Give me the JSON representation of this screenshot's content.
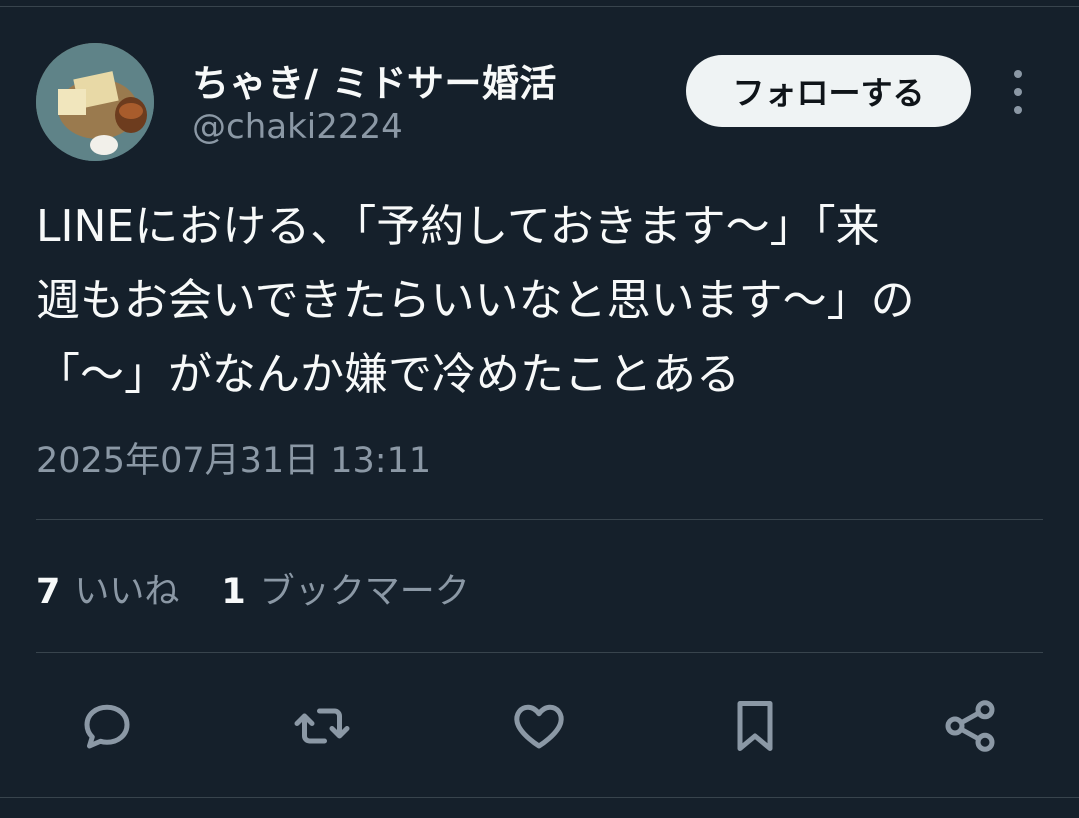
{
  "author": {
    "display_name": "ちゃき/ ミドサー婚活",
    "handle": "@chaki2224"
  },
  "follow_label": "フォローする",
  "tweet": {
    "lines": [
      "LINEにおける、「予約しておきます〜」「来",
      "週もお会いできたらいいなと思います〜」の",
      "「〜」がなんか嫌で冷めたことある"
    ],
    "timestamp": "2025年07月31日 13:11"
  },
  "stats": {
    "likes_count": "7",
    "likes_label": "いいね",
    "bookmarks_count": "1",
    "bookmarks_label": "ブックマーク"
  },
  "actions": [
    "reply-icon",
    "retweet-icon",
    "like-icon",
    "bookmark-icon",
    "share-icon"
  ],
  "colors": {
    "background": "#15202b",
    "primary_text": "#f7f9f9",
    "secondary_text": "#8b98a5",
    "divider": "#38444d",
    "follow_button_bg": "#eff3f4"
  }
}
